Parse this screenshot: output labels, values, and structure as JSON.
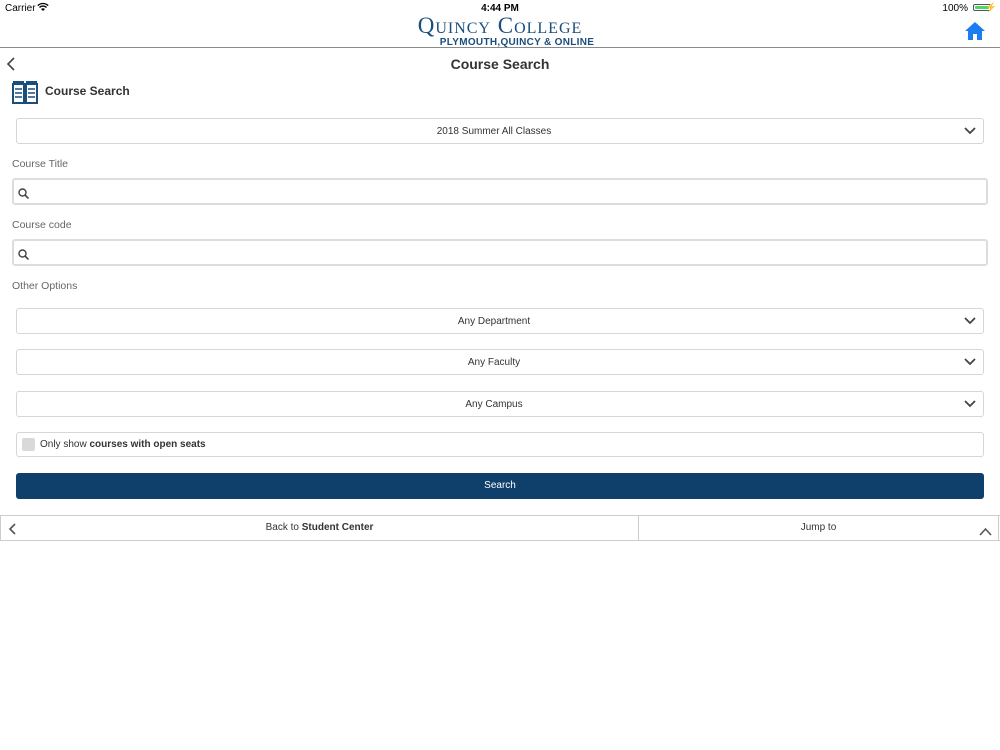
{
  "status": {
    "carrier": "Carrier",
    "time": "4:44 PM",
    "battery": "100%",
    "battery_level": 1.0
  },
  "header": {
    "logo_line1": "Quincy College",
    "logo_line2": "PLYMOUTH,QUINCY & ONLINE",
    "home_icon": "home-icon"
  },
  "nav": {
    "title": "Course Search",
    "back_icon": "chevron-left-icon"
  },
  "section": {
    "title": "Course Search",
    "icon": "book-icon"
  },
  "term_select": {
    "value": "2018 Summer All Classes"
  },
  "course_title": {
    "label": "Course Title",
    "value": "",
    "placeholder": ""
  },
  "course_code": {
    "label": "Course code",
    "value": "",
    "placeholder": ""
  },
  "other_options": {
    "label": "Other Options"
  },
  "department_select": {
    "value": "Any Department"
  },
  "faculty_select": {
    "value": "Any Faculty"
  },
  "campus_select": {
    "value": "Any Campus"
  },
  "open_seats": {
    "prefix": "Only show ",
    "bold": "courses with open seats",
    "checked": false
  },
  "search_button": {
    "label": "Search"
  },
  "footer": {
    "back_prefix": "Back to ",
    "back_bold": "Student Center",
    "jump_label": "Jump to"
  },
  "colors": {
    "brand": "#1a4e7d",
    "button": "#0f3f6b",
    "home_icon": "#1a7ef2"
  }
}
